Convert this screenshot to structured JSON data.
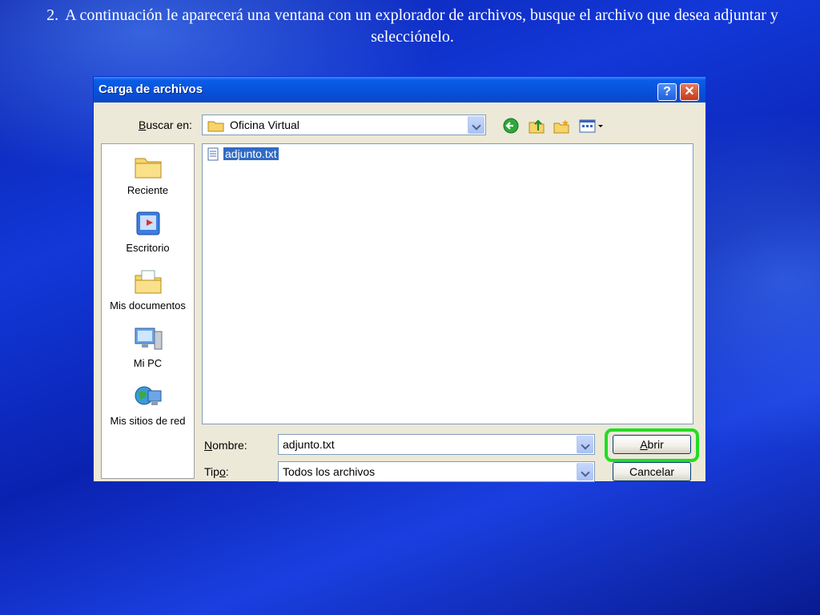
{
  "caption": {
    "number": "2.",
    "text": "A continuación le aparecerá una ventana con un explorador de archivos, busque el archivo que desea adjuntar y selecciónelo."
  },
  "dialog": {
    "title": "Carga de archivos",
    "help_label": "?",
    "close_label": "✕",
    "look_in": {
      "label_key": "B",
      "label_rest": "uscar en:",
      "value": "Oficina Virtual"
    },
    "nav_icons": [
      "back-icon",
      "up-folder-icon",
      "new-folder-icon",
      "view-menu-icon"
    ],
    "places": [
      {
        "label": "Reciente",
        "icon": "recent-folder-icon"
      },
      {
        "label": "Escritorio",
        "icon": "desktop-icon"
      },
      {
        "label": "Mis documentos",
        "icon": "my-documents-icon"
      },
      {
        "label": "Mi PC",
        "icon": "my-computer-icon"
      },
      {
        "label": "Mis sitios de red",
        "icon": "network-places-icon"
      }
    ],
    "files": [
      {
        "name": "adjunto.txt",
        "icon": "text-file-icon"
      }
    ],
    "filename": {
      "label_key": "N",
      "label_rest": "ombre:",
      "value": "adjunto.txt"
    },
    "filetype": {
      "label_pre": "Tip",
      "label_key": "o",
      "label_post": ":",
      "value": "Todos los archivos"
    },
    "open_button": {
      "key": "A",
      "rest": "brir"
    },
    "cancel_button": "Cancelar"
  },
  "colors": {
    "highlight": "#22dd22",
    "titlebar": "#0a5ee8",
    "selection": "#316ac5"
  }
}
